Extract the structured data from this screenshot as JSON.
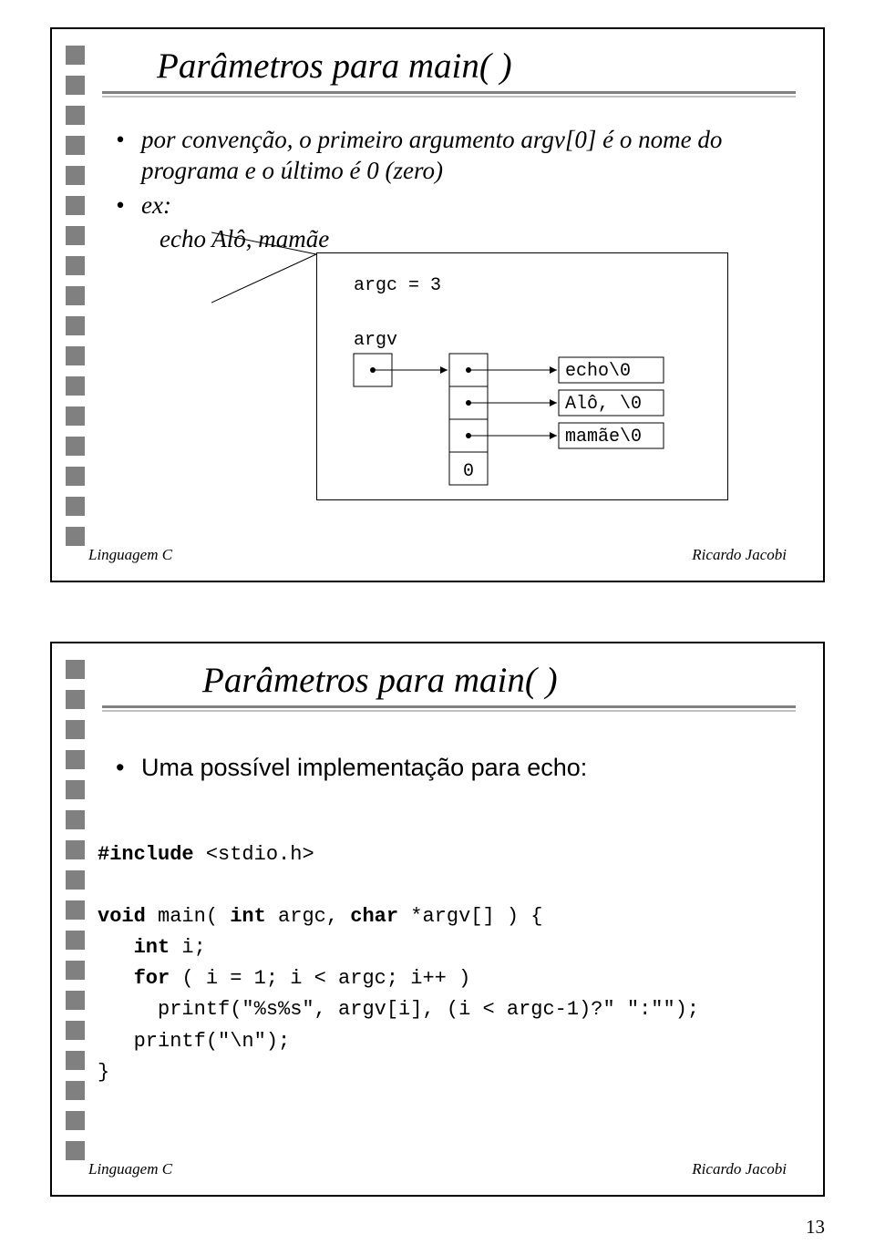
{
  "slide1": {
    "title": "Parâmetros para main( )",
    "bullet1": "por convenção, o primeiro argumento argv[0] é o nome do programa e o último é 0 (zero)",
    "bullet2_label": "ex:",
    "bullet2_body": "echo Alô, mamãe",
    "diagram": {
      "argc_label": "argc = 3",
      "argv_label": "argv",
      "ptr0": "echo\\0",
      "ptr1": "Alô, \\0",
      "ptr2": "mamãe\\0",
      "null_label": "0"
    },
    "footer_left": "Linguagem C",
    "footer_right": "Ricardo Jacobi"
  },
  "slide2": {
    "title": "Parâmetros para main( )",
    "bullet1": "Uma possível implementação para echo:",
    "code": {
      "kw_include": "#include",
      "include_arg": " <stdio.h>",
      "kw_void": "void",
      "main_sig1": " main( ",
      "kw_int1": "int",
      "main_sig2": " argc, ",
      "kw_char": "char",
      "main_sig3": " *argv[] ) {",
      "line_int": "   ",
      "kw_int2": "int",
      "line_int2": " i;",
      "line_for1": "   ",
      "kw_for": "for",
      "line_for2": " ( i = 1; i < argc; i++ )",
      "line_printf1": "     printf(\"%s%s\", argv[i], (i < argc-1)?\" \":\"\");",
      "line_printf2": "   printf(\"\\n\");",
      "line_close": "}"
    },
    "footer_left": "Linguagem C",
    "footer_right": "Ricardo Jacobi"
  },
  "page_number": "13"
}
